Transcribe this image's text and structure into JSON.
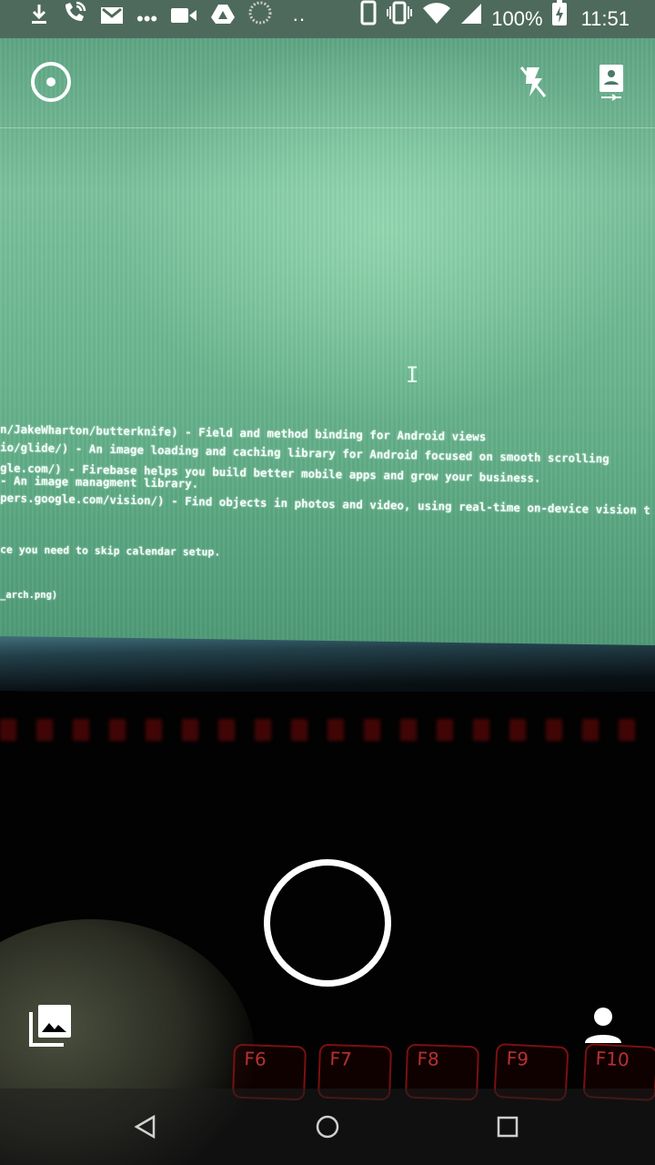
{
  "status_bar": {
    "battery_percent": "100%",
    "time": "11:51",
    "dots": "•••",
    "dots2": "··",
    "icons": [
      "download-icon",
      "wifi-call-icon",
      "gmail-icon",
      "more-notifications-icon",
      "video-icon",
      "drive-icon",
      "sync-icon",
      "phone-icon",
      "vibrate-icon",
      "wifi-icon",
      "signal-icon",
      "battery-charging-icon"
    ]
  },
  "camera": {
    "top_icons": [
      "shutter-mode-icon",
      "flash-off-icon",
      "document-capture-icon"
    ],
    "bottom_icons": [
      "gallery-icon",
      "switch-profile-icon"
    ],
    "shutter_icon": "shutter-button"
  },
  "viewfinder_text": {
    "cursor": "I",
    "lines": [
      "n/JakeWharton/butterknife) - Field and method binding for Android views",
      "io/glide/) - An image loading and caching library for Android focused on smooth scrolling",
      "gle.com/) - Firebase helps you build better mobile apps and grow your business.",
      "- An image managment library.",
      "pers.google.com/vision/) - Find objects in photos and video, using real-time on-device vision t",
      "ce you need to skip calendar setup.",
      "_arch.png)"
    ],
    "keys": [
      "F6",
      "F7",
      "F8",
      "F9",
      "F10"
    ]
  },
  "nav_bar": {
    "buttons": [
      "back-icon",
      "home-icon",
      "recents-icon"
    ]
  }
}
